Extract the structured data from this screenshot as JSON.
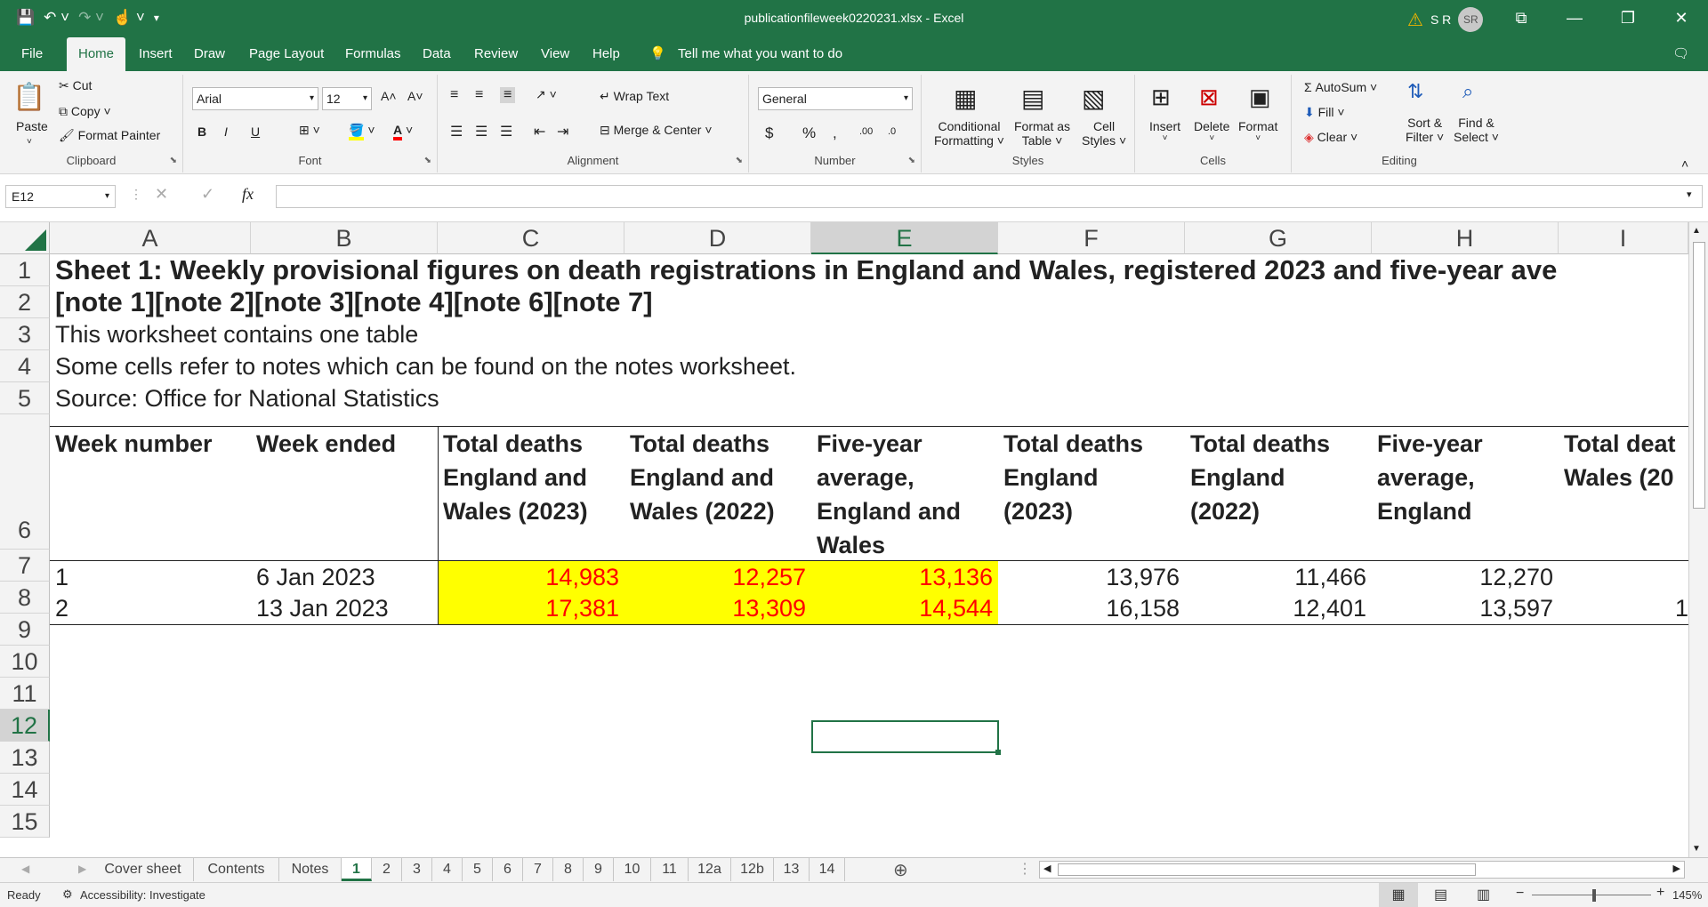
{
  "window": {
    "title": "publicationfileweek0220231.xlsx  -  Excel",
    "user_initials": "S R",
    "avatar_text": "SR",
    "minimize": "—",
    "restore": "❐",
    "close": "✕",
    "fullscreen": "⧉"
  },
  "qat": {
    "save": "💾",
    "undo": "↶ ˅",
    "redo": "↷ ˅",
    "touch": "☝ ˅",
    "customize": "▾"
  },
  "tabs": [
    "File",
    "Home",
    "Insert",
    "Draw",
    "Page Layout",
    "Formulas",
    "Data",
    "Review",
    "View",
    "Help"
  ],
  "active_tab": "Home",
  "tell_me": "Tell me what you want to do",
  "ribbon": {
    "clipboard": {
      "paste": "Paste",
      "cut": "Cut",
      "copy": "Copy",
      "format_painter": "Format Painter",
      "label": "Clipboard"
    },
    "font": {
      "name": "Arial",
      "size": "12",
      "label": "Font",
      "bold": "B",
      "italic": "I",
      "underline": "U",
      "grow": "A˄",
      "shrink": "A˅"
    },
    "alignment": {
      "wrap": "Wrap Text",
      "merge": "Merge & Center",
      "label": "Alignment"
    },
    "number": {
      "format": "General",
      "currency": "$",
      "percent": "%",
      "comma": ",",
      "inc_dec": ".00",
      "dec_dec": ".0",
      "label": "Number"
    },
    "styles": {
      "conditional": "Conditional",
      "conditional2": "Formatting ˅",
      "format_table": "Format as",
      "format_table2": "Table ˅",
      "cell_styles": "Cell",
      "cell_styles2": "Styles ˅",
      "label": "Styles"
    },
    "cells": {
      "insert": "Insert",
      "delete": "Delete",
      "format": "Format",
      "label": "Cells"
    },
    "editing": {
      "autosum": "AutoSum",
      "fill": "Fill",
      "clear": "Clear",
      "sort": "Sort &",
      "sort2": "Filter ˅",
      "find": "Find &",
      "find2": "Select ˅",
      "label": "Editing"
    }
  },
  "formula_bar": {
    "name_box": "E12",
    "fx": "fx",
    "value": ""
  },
  "columns": [
    "A",
    "B",
    "C",
    "D",
    "E",
    "F",
    "G",
    "H",
    "I"
  ],
  "selected_column": "E",
  "rows": [
    "1",
    "2",
    "3",
    "4",
    "5",
    "6",
    "7",
    "8",
    "9",
    "10",
    "11",
    "12",
    "13",
    "14",
    "15"
  ],
  "selected_row": "12",
  "sheet": {
    "title_line1": "Sheet 1: Weekly provisional figures on death registrations in England and Wales, registered 2023 and five-year ave",
    "title_line2": "[note 1][note 2][note 3][note 4][note 6][note 7]",
    "line3": "This worksheet contains one table",
    "line4": "Some cells refer to notes which can be found on the notes worksheet.",
    "line5": "Source: Office for National Statistics",
    "headers": [
      [
        "Week number"
      ],
      [
        "Week ended"
      ],
      [
        "Total deaths",
        "England and",
        "Wales (2023)"
      ],
      [
        "Total deaths",
        "England and",
        "Wales (2022)"
      ],
      [
        "Five-year",
        "average,",
        "England and",
        "Wales"
      ],
      [
        "Total deaths",
        "England",
        "(2023)"
      ],
      [
        "Total deaths",
        "England",
        "(2022)"
      ],
      [
        "Five-year",
        "average,",
        "England"
      ],
      [
        "Total deat",
        "Wales (20"
      ]
    ],
    "data_rows": [
      {
        "week": "1",
        "ended": "6 Jan 2023",
        "c": "14,983",
        "d": "12,257",
        "e": "13,136",
        "f": "13,976",
        "g": "11,466",
        "h": "12,270",
        "i": ""
      },
      {
        "week": "2",
        "ended": "13 Jan 2023",
        "c": "17,381",
        "d": "13,309",
        "e": "14,544",
        "f": "16,158",
        "g": "12,401",
        "h": "13,597",
        "i": "1"
      }
    ]
  },
  "sheet_tabs": [
    "Cover sheet",
    "Contents",
    "Notes",
    "1",
    "2",
    "3",
    "4",
    "5",
    "6",
    "7",
    "8",
    "9",
    "10",
    "11",
    "12a",
    "12b",
    "13",
    "14"
  ],
  "active_sheet": "1",
  "status": {
    "ready": "Ready",
    "accessibility": "Accessibility: Investigate",
    "zoom": "145%"
  },
  "colors": {
    "accent": "#217346",
    "highlight": "#ffff00",
    "red_text": "#ff0000"
  }
}
